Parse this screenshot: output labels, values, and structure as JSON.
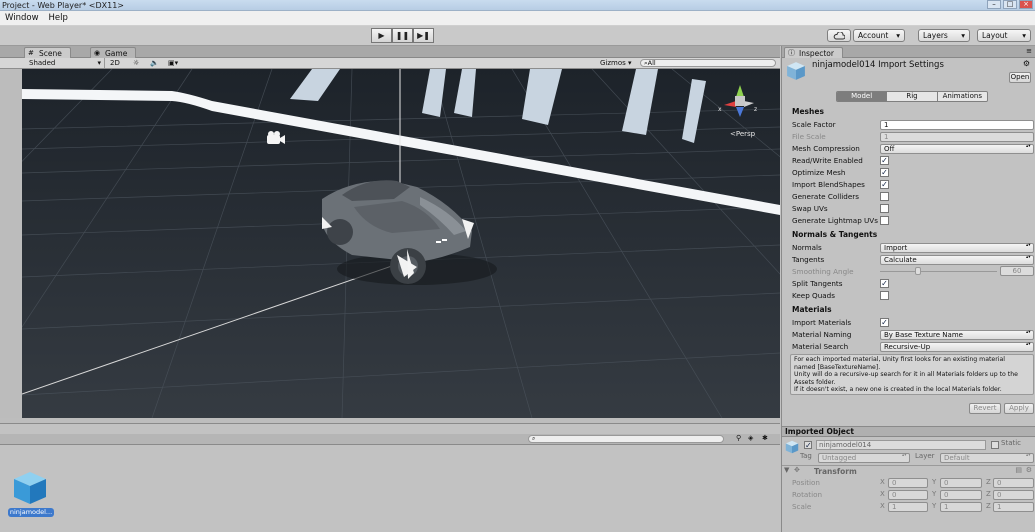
{
  "window": {
    "title": "Project - Web Player* <DX11>"
  },
  "menu": {
    "items": [
      "Window",
      "Help"
    ]
  },
  "toolbar": {
    "play_icon": "play-icon",
    "pause_icon": "pause-icon",
    "step_icon": "step-icon",
    "cloud_icon": "cloud-icon",
    "account": "Account",
    "layers": "Layers",
    "layout": "Layout"
  },
  "scene": {
    "tabs": [
      "Scene",
      "Game"
    ],
    "shading_mode": "Shaded",
    "mode_2d": "2D",
    "gizmos": "Gizmos",
    "search_prefix": "All",
    "persp_label": "Persp"
  },
  "inspector": {
    "tab": "Inspector",
    "title": "ninjamodel014 Import Settings",
    "open_button": "Open",
    "subtabs": [
      "Model",
      "Rig",
      "Animations"
    ],
    "meshes": {
      "header": "Meshes",
      "scale_factor_label": "Scale Factor",
      "scale_factor": "1",
      "file_scale_label": "File Scale",
      "file_scale": "1",
      "mesh_compression_label": "Mesh Compression",
      "mesh_compression": "Off",
      "read_write_label": "Read/Write Enabled",
      "optimize_mesh_label": "Optimize Mesh",
      "import_blendshapes_label": "Import BlendShapes",
      "generate_colliders_label": "Generate Colliders",
      "swap_uvs_label": "Swap UVs",
      "generate_lightmap_label": "Generate Lightmap UVs"
    },
    "normals": {
      "header": "Normals & Tangents",
      "normals_label": "Normals",
      "normals": "Import",
      "tangents_label": "Tangents",
      "tangents": "Calculate",
      "smoothing_label": "Smoothing Angle",
      "smoothing": "60",
      "split_label": "Split Tangents",
      "keep_quads_label": "Keep Quads"
    },
    "materials": {
      "header": "Materials",
      "import_label": "Import Materials",
      "naming_label": "Material Naming",
      "naming": "By Base Texture Name",
      "search_label": "Material Search",
      "search": "Recursive-Up",
      "help_lines": [
        "For each imported material, Unity first looks for an existing material",
        "named [BaseTextureName].",
        "Unity will do a recursive-up search for it in all Materials folders up to the",
        "Assets folder.",
        "If it doesn't exist, a new one is created in the local Materials folder."
      ]
    },
    "revert": "Revert",
    "apply": "Apply",
    "imported_object": {
      "header": "Imported Object",
      "name": "ninjamodel014",
      "static_label": "Static",
      "tag_label": "Tag",
      "tag": "Untagged",
      "layer_label": "Layer",
      "layer": "Default"
    },
    "transform": {
      "header": "Transform",
      "position_label": "Position",
      "rotation_label": "Rotation",
      "scale_label": "Scale",
      "axis_x": "X",
      "axis_y": "Y",
      "axis_z": "Z",
      "position": [
        "0",
        "0",
        "0"
      ],
      "rotation": [
        "0",
        "0",
        "0"
      ],
      "scale": [
        "1",
        "1",
        "1"
      ]
    }
  },
  "project": {
    "asset_label": "ninjamodel..."
  }
}
